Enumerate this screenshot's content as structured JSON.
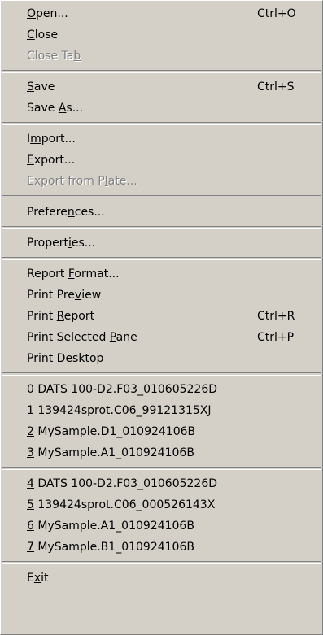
{
  "menu": {
    "groups": [
      [
        {
          "pre": "",
          "mn": "O",
          "post": "pen...",
          "shortcut": "Ctrl+O",
          "enabled": true,
          "name": "open"
        },
        {
          "pre": "",
          "mn": "C",
          "post": "lose",
          "shortcut": "",
          "enabled": true,
          "name": "close"
        },
        {
          "pre": "Close Ta",
          "mn": "b",
          "post": "",
          "shortcut": "",
          "enabled": false,
          "name": "close-tab"
        }
      ],
      [
        {
          "pre": "",
          "mn": "S",
          "post": "ave",
          "shortcut": "Ctrl+S",
          "enabled": true,
          "name": "save"
        },
        {
          "pre": "Save ",
          "mn": "A",
          "post": "s...",
          "shortcut": "",
          "enabled": true,
          "name": "save-as"
        }
      ],
      [
        {
          "pre": "I",
          "mn": "m",
          "post": "port...",
          "shortcut": "",
          "enabled": true,
          "name": "import"
        },
        {
          "pre": "",
          "mn": "E",
          "post": "xport...",
          "shortcut": "",
          "enabled": true,
          "name": "export"
        },
        {
          "pre": "Export from P",
          "mn": "l",
          "post": "ate...",
          "shortcut": "",
          "enabled": false,
          "name": "export-from-plate"
        }
      ],
      [
        {
          "pre": "Prefere",
          "mn": "n",
          "post": "ces...",
          "shortcut": "",
          "enabled": true,
          "name": "preferences"
        }
      ],
      [
        {
          "pre": "Propert",
          "mn": "i",
          "post": "es...",
          "shortcut": "",
          "enabled": true,
          "name": "properties"
        }
      ],
      [
        {
          "pre": "Report ",
          "mn": "F",
          "post": "ormat...",
          "shortcut": "",
          "enabled": true,
          "name": "report-format"
        },
        {
          "pre": "Print Pre",
          "mn": "v",
          "post": "iew",
          "shortcut": "",
          "enabled": true,
          "name": "print-preview"
        },
        {
          "pre": "Print ",
          "mn": "R",
          "post": "eport",
          "shortcut": "Ctrl+R",
          "enabled": true,
          "name": "print-report"
        },
        {
          "pre": "Print Selected ",
          "mn": "P",
          "post": "ane",
          "shortcut": "Ctrl+P",
          "enabled": true,
          "name": "print-selected-pane"
        },
        {
          "pre": "Print ",
          "mn": "D",
          "post": "esktop",
          "shortcut": "",
          "enabled": true,
          "name": "print-desktop"
        }
      ],
      [
        {
          "pre": "",
          "mn": "0",
          "post": " DATS 100-D2.F03_010605226D",
          "shortcut": "",
          "enabled": true,
          "name": "recent-file-0"
        },
        {
          "pre": "",
          "mn": "1",
          "post": " 139424sprot.C06_99121315XJ",
          "shortcut": "",
          "enabled": true,
          "name": "recent-file-1"
        },
        {
          "pre": "",
          "mn": "2",
          "post": " MySample.D1_010924106B",
          "shortcut": "",
          "enabled": true,
          "name": "recent-file-2"
        },
        {
          "pre": "",
          "mn": "3",
          "post": " MySample.A1_010924106B",
          "shortcut": "",
          "enabled": true,
          "name": "recent-file-3"
        }
      ],
      [
        {
          "pre": "",
          "mn": "4",
          "post": " DATS 100-D2.F03_010605226D",
          "shortcut": "",
          "enabled": true,
          "name": "recent-file-4"
        },
        {
          "pre": "",
          "mn": "5",
          "post": " 139424sprot.C06_000526143X",
          "shortcut": "",
          "enabled": true,
          "name": "recent-file-5"
        },
        {
          "pre": "",
          "mn": "6",
          "post": " MySample.A1_010924106B",
          "shortcut": "",
          "enabled": true,
          "name": "recent-file-6"
        },
        {
          "pre": "",
          "mn": "7",
          "post": " MySample.B1_010924106B",
          "shortcut": "",
          "enabled": true,
          "name": "recent-file-7"
        }
      ],
      [
        {
          "pre": "E",
          "mn": "x",
          "post": "it",
          "shortcut": "",
          "enabled": true,
          "name": "exit"
        }
      ]
    ]
  },
  "colors": {
    "menu_background": "#d4d0c8",
    "disabled_text": "#808080"
  }
}
